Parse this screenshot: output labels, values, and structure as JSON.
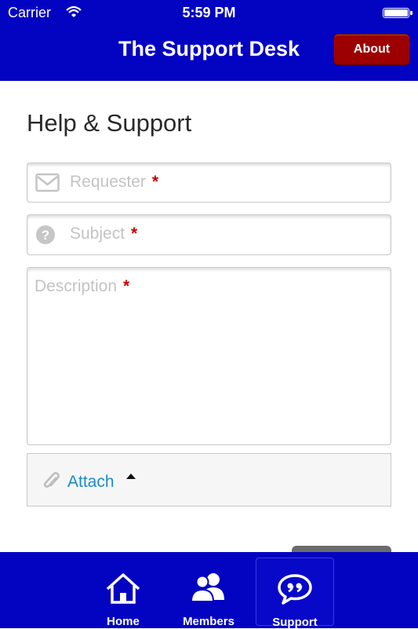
{
  "status_bar": {
    "carrier": "Carrier",
    "time": "5:59 PM"
  },
  "header": {
    "title": "The Support Desk",
    "about_label": "About"
  },
  "main": {
    "heading": "Help & Support",
    "fields": [
      {
        "placeholder": "Requester",
        "required_mark": "*",
        "icon": "envelope-icon"
      },
      {
        "placeholder": "Subject",
        "required_mark": "*",
        "icon": "question-icon"
      },
      {
        "placeholder": "Description",
        "required_mark": "*"
      }
    ],
    "attach": {
      "label": "Attach",
      "icon": "paperclip-icon"
    }
  },
  "tabbar": {
    "tabs": [
      {
        "label": "Home",
        "icon": "home-icon"
      },
      {
        "label": "Members",
        "icon": "members-icon"
      },
      {
        "label": "Support",
        "icon": "speech-bubble-icon",
        "active": true
      }
    ]
  },
  "colors": {
    "header_bg": "#0303c2",
    "about_bg": "#9c0000",
    "link": "#1a8bc9",
    "required": "#c90000"
  }
}
